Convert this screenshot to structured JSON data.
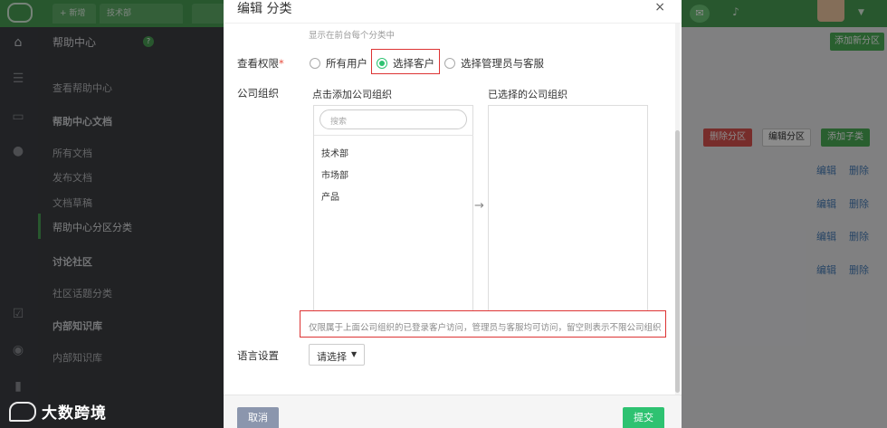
{
  "topbar": {
    "tabs": [
      "+ 新增",
      "技术部"
    ],
    "chat_icon": "chat-icon",
    "bell_icon": "bell-icon"
  },
  "sidebar": {
    "title": "帮助中心",
    "items": [
      {
        "label": "查看帮助中心",
        "type": "item"
      },
      {
        "label": "帮助中心文档",
        "type": "head"
      },
      {
        "label": "所有文档",
        "type": "item"
      },
      {
        "label": "发布文档",
        "type": "item"
      },
      {
        "label": "文档草稿",
        "type": "item"
      },
      {
        "label": "帮助中心分区分类",
        "type": "current"
      },
      {
        "label": "讨论社区",
        "type": "head"
      },
      {
        "label": "社区话题分类",
        "type": "item"
      },
      {
        "label": "内部知识库",
        "type": "head"
      },
      {
        "label": "内部知识库",
        "type": "item"
      }
    ]
  },
  "main": {
    "add_section": "添加新分区",
    "delete_section": "删除分区",
    "edit_section": "编辑分区",
    "add_subcategory": "添加子类",
    "row_edit": "编辑",
    "row_delete": "删除"
  },
  "modal": {
    "title": "编辑 分类",
    "close": "×",
    "hint_top": "显示在前台每个分类中",
    "permission_label": "查看权限",
    "required_mark": "*",
    "radios": [
      {
        "label": "所有用户",
        "checked": false
      },
      {
        "label": "选择客户",
        "checked": true
      },
      {
        "label": "选择管理员与客服",
        "checked": false
      }
    ],
    "company_label": "公司组织",
    "add_org_title": "点击添加公司组织",
    "selected_org_title": "已选择的公司组织",
    "search_placeholder": "搜索",
    "orgs": [
      "技术部",
      "市场部",
      "产品"
    ],
    "arrow": "→",
    "hint_bottom": "仅限属于上面公司组织的已登录客户访问，管理员与客服均可访问，留空则表示不限公司组织",
    "language_label": "语言设置",
    "language_select": "请选择",
    "cancel": "取消",
    "submit": "提交"
  },
  "watermark": "大数跨境",
  "colors": {
    "brand_green": "#4a9e55",
    "submit_green": "#2ec271",
    "cancel_gray": "#8b96ad",
    "highlight_red": "#dd3333"
  }
}
